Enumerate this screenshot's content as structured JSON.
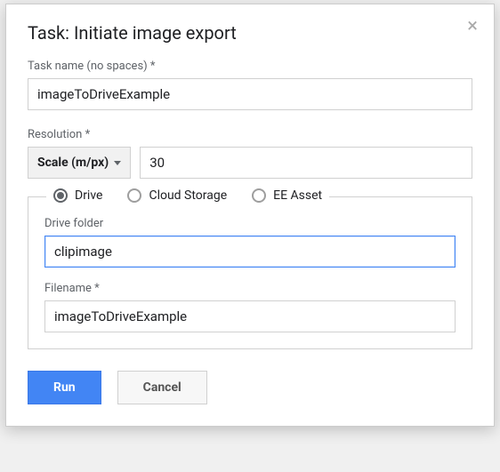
{
  "dialog": {
    "title": "Task: Initiate image export",
    "close_glyph": "×"
  },
  "task_name": {
    "label": "Task name (no spaces) *",
    "value": "imageToDriveExample"
  },
  "resolution": {
    "label": "Resolution *",
    "scale_label": "Scale (m/px)",
    "value": "30"
  },
  "destination": {
    "options": [
      {
        "label": "Drive",
        "checked": true
      },
      {
        "label": "Cloud Storage",
        "checked": false
      },
      {
        "label": "EE Asset",
        "checked": false
      }
    ],
    "drive_folder": {
      "label": "Drive folder",
      "value": "clipimage"
    },
    "filename": {
      "label": "Filename *",
      "value": "imageToDriveExample"
    }
  },
  "footer": {
    "run": "Run",
    "cancel": "Cancel"
  }
}
